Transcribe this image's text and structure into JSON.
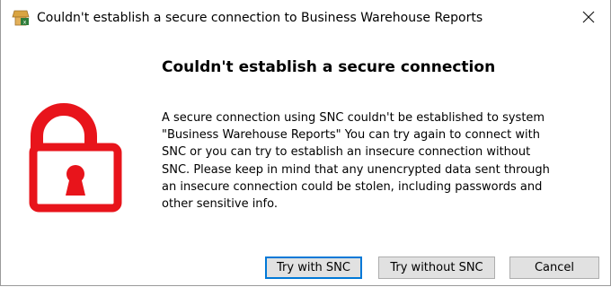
{
  "window": {
    "title": "Couldn't establish a secure connection to Business Warehouse Reports",
    "app_icon": "sap-logon-icon",
    "close_icon": "close-icon"
  },
  "dialog": {
    "icon": "unlocked-padlock-icon",
    "icon_color": "#e8141b",
    "heading": "Couldn't establish a secure connection",
    "message_lines": [
      "A secure connection using SNC couldn't be established to system",
      "\"Business Warehouse Reports\" You can try again to connect with",
      "SNC or you can try to establish an insecure connection without",
      "SNC. Please keep in mind that any unencrypted data sent through",
      "an insecure connection could be stolen, including passwords and",
      "other sensitive info."
    ]
  },
  "buttons": {
    "try_snc": "Try with SNC",
    "try_without_snc": "Try without SNC",
    "cancel": "Cancel"
  }
}
